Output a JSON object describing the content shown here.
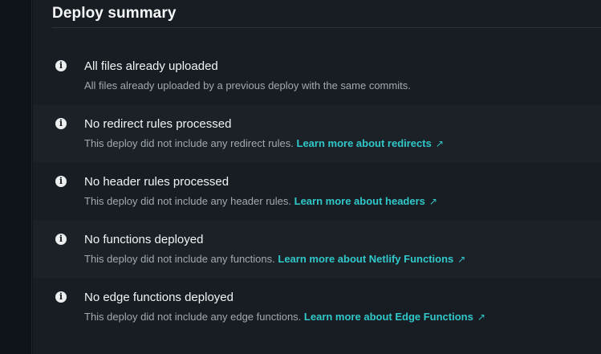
{
  "summary": {
    "title": "Deploy summary",
    "items": [
      {
        "title": "All files already uploaded",
        "description": "All files already uploaded by a previous deploy with the same commits.",
        "link": "",
        "icon": "info-icon"
      },
      {
        "title": "No redirect rules processed",
        "description": "This deploy did not include any redirect rules.",
        "link": "Learn more about redirects",
        "icon": "info-icon"
      },
      {
        "title": "No header rules processed",
        "description": "This deploy did not include any header rules.",
        "link": "Learn more about headers",
        "icon": "info-icon"
      },
      {
        "title": "No functions deployed",
        "description": "This deploy did not include any functions.",
        "link": "Learn more about Netlify Functions",
        "icon": "info-icon"
      },
      {
        "title": "No edge functions deployed",
        "description": "This deploy did not include any edge functions.",
        "link": "Learn more about Edge Functions",
        "icon": "info-icon"
      }
    ]
  },
  "icons": {
    "info": "i",
    "external_link": "↗"
  },
  "colors": {
    "background": "#0e1419",
    "card": "#181d23",
    "row_shade": "#1c2128",
    "title_text": "#f6f7f8",
    "description_text": "#a3a9b0",
    "link": "#30c8c9"
  }
}
